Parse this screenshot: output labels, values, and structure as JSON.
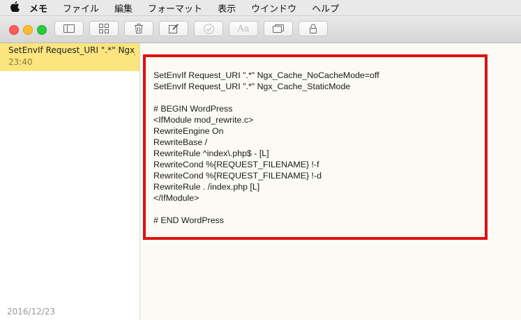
{
  "menubar": {
    "apple_icon": "apple-logo",
    "app_name": "メモ",
    "items": [
      "ファイル",
      "編集",
      "フォーマット",
      "表示",
      "ウインドウ",
      "ヘルプ"
    ]
  },
  "toolbar": {
    "buttons": [
      "sidebar-toggle-icon",
      "grid-view-icon",
      "trash-icon",
      "compose-icon",
      "checklist-icon",
      "font-icon",
      "attachments-icon",
      "lock-icon"
    ],
    "font_button_label": "Aa"
  },
  "sidebar": {
    "notes": [
      {
        "title": "SetEnvIf Request_URI \".*\" Ngx_...",
        "time": "23:40"
      }
    ],
    "footer_date": "2016/12/23"
  },
  "editor": {
    "lines": [
      "SetEnvIf Request_URI \".*\" Ngx_Cache_NoCacheMode=off",
      "SetEnvIf Request_URI \".*\" Ngx_Cache_StaticMode",
      "",
      "# BEGIN WordPress",
      "<IfModule mod_rewrite.c>",
      "RewriteEngine On",
      "RewriteBase /",
      "RewriteRule ^index\\.php$ - [L]",
      "RewriteCond %{REQUEST_FILENAME} !-f",
      "RewriteCond %{REQUEST_FILENAME} !-d",
      "RewriteRule . /index.php [L]",
      "</IfModule>",
      "",
      "# END WordPress"
    ]
  },
  "colors": {
    "selected_note_bg": "#fbe57e",
    "highlight_frame": "#e01010",
    "editor_bg": "#fbfaf4"
  }
}
